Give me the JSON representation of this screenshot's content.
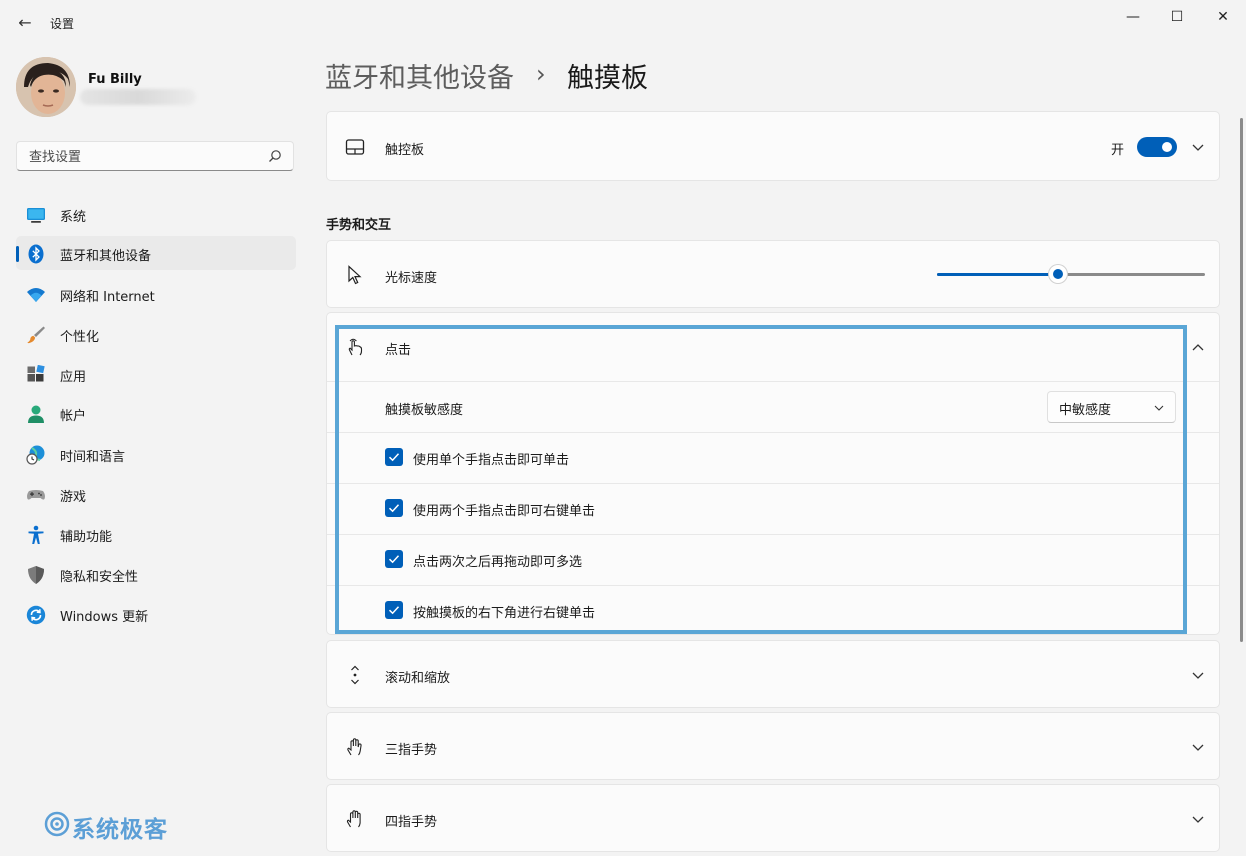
{
  "window": {
    "title": "设置",
    "back_glyph": "←",
    "minimize_glyph": "—",
    "maximize_glyph": "☐",
    "close_glyph": "✕"
  },
  "user": {
    "name": "Fu Billy"
  },
  "search": {
    "placeholder": "查找设置",
    "icon": "search-icon"
  },
  "sidebar": {
    "items": [
      {
        "label": "系统",
        "icon": "system-icon"
      },
      {
        "label": "蓝牙和其他设备",
        "icon": "bluetooth-icon",
        "selected": true
      },
      {
        "label": "网络和 Internet",
        "icon": "wifi-icon"
      },
      {
        "label": "个性化",
        "icon": "brush-icon"
      },
      {
        "label": "应用",
        "icon": "apps-icon"
      },
      {
        "label": "帐户",
        "icon": "account-icon"
      },
      {
        "label": "时间和语言",
        "icon": "time-language-icon"
      },
      {
        "label": "游戏",
        "icon": "gamepad-icon"
      },
      {
        "label": "辅助功能",
        "icon": "accessibility-icon"
      },
      {
        "label": "隐私和安全性",
        "icon": "shield-icon"
      },
      {
        "label": "Windows 更新",
        "icon": "update-icon"
      }
    ]
  },
  "breadcrumb": {
    "parent": "蓝牙和其他设备",
    "separator": "›",
    "current": "触摸板"
  },
  "touchpad": {
    "label": "触控板",
    "toggle_label": "开",
    "toggle_on": true
  },
  "section_title": "手势和交互",
  "cursor_speed": {
    "label": "光标速度",
    "value": 0.45
  },
  "tap": {
    "label": "点击",
    "sensitivity_label": "触摸板敏感度",
    "sensitivity_value": "中敏感度",
    "options": [
      {
        "label": "使用单个手指点击即可单击",
        "checked": true
      },
      {
        "label": "使用两个手指点击即可右键单击",
        "checked": true
      },
      {
        "label": "点击两次之后再拖动即可多选",
        "checked": true
      },
      {
        "label": "按触摸板的右下角进行右键单击",
        "checked": true
      }
    ]
  },
  "scroll_zoom": {
    "label": "滚动和缩放"
  },
  "three_finger": {
    "label": "三指手势"
  },
  "four_finger": {
    "label": "四指手势"
  },
  "watermark": {
    "text": "系统极客"
  },
  "colors": {
    "accent": "#005fb8",
    "highlight_border": "#5aa6d6",
    "watermark": "#5c9fd6"
  }
}
